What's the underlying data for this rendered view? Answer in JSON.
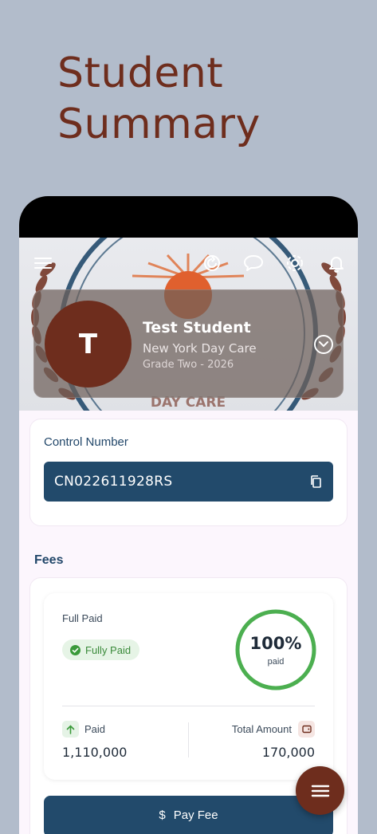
{
  "page": {
    "title_line1": "Student",
    "title_line2": "Summary"
  },
  "header": {
    "icons": [
      "menu-icon",
      "refresh-icon",
      "chat-icon",
      "settings-icon",
      "notification-bell-icon"
    ],
    "logo_text": "DAY CARE"
  },
  "profile": {
    "initial": "T",
    "name": "Test Student",
    "school": "New York Day Care",
    "grade": "Grade Two - 2026"
  },
  "control": {
    "label": "Control Number",
    "value": "CN022611928RS"
  },
  "fees": {
    "section_title": "Fees",
    "status_label": "Full Paid",
    "badge_text": "Fully Paid",
    "percent_text": "100%",
    "percent_value": 100,
    "percent_sub": "paid",
    "paid_label": "Paid",
    "paid_value": "1,110,000",
    "total_label": "Total Amount",
    "total_value": "170,000"
  },
  "actions": {
    "pay_fee_label": "Pay Fee",
    "pay_fee_symbol": "$"
  },
  "colors": {
    "brand": "#6e2d1d",
    "navy": "#224a6b",
    "success": "#4caf50",
    "background": "#b2bccb"
  }
}
